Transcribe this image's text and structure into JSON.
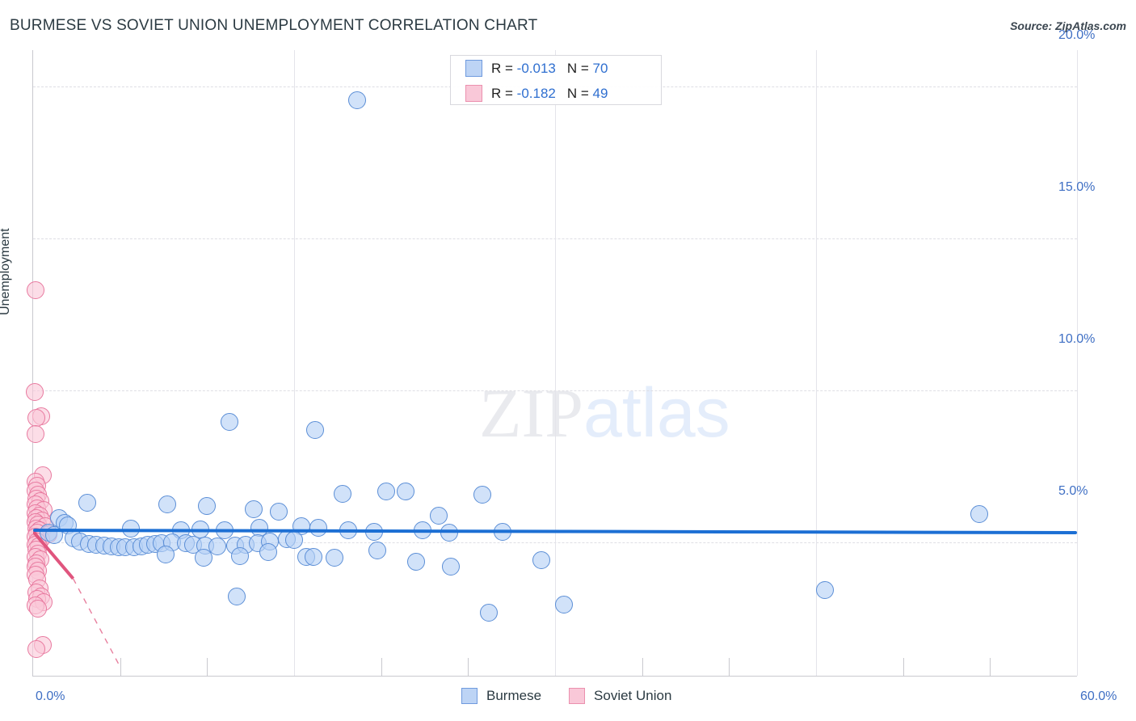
{
  "header": {
    "title": "BURMESE VS SOVIET UNION UNEMPLOYMENT CORRELATION CHART",
    "source": "Source: ZipAtlas.com"
  },
  "watermark": {
    "part1": "ZIP",
    "part2": "atlas"
  },
  "stats": {
    "rows": [
      {
        "series": "Burmese",
        "r_prefix": "R = ",
        "r_value": "-0.013",
        "n_prefix": "N = ",
        "n_value": "70",
        "color": "#bdd4f5"
      },
      {
        "series": "Soviet Union",
        "r_prefix": "R = ",
        "r_value": "-0.182",
        "n_prefix": "N = ",
        "n_value": "49",
        "color": "#f9c8d8"
      }
    ]
  },
  "legend": {
    "items": [
      {
        "label": "Burmese",
        "color": "#bdd4f5"
      },
      {
        "label": "Soviet Union",
        "color": "#f9c8d8"
      }
    ]
  },
  "axes": {
    "y_title": "Unemployment",
    "y_ticks": [
      "20.0%",
      "15.0%",
      "10.0%",
      "5.0%"
    ],
    "x_min_label": "0.0%",
    "x_max_label": "60.0%"
  },
  "chart_data": {
    "type": "scatter",
    "title": "BURMESE VS SOVIET UNION UNEMPLOYMENT CORRELATION CHART",
    "xlabel": "",
    "ylabel": "Unemployment",
    "xlim": [
      0,
      60
    ],
    "ylim": [
      0.6,
      21.2
    ],
    "x_unit": "%",
    "y_unit": "%",
    "grid": true,
    "x_ticks": [
      0,
      5,
      10,
      15,
      20,
      25,
      30,
      35,
      40,
      45,
      50,
      55,
      60
    ],
    "y_ticks": [
      5,
      10,
      15,
      20
    ],
    "legend_position": "bottom",
    "series": [
      {
        "name": "Burmese",
        "color": "#bdd4f5",
        "border_color": "#5b8ed6",
        "r": -0.013,
        "n": 70,
        "trend": {
          "type": "linear",
          "x0": 0,
          "y0": 5.38,
          "x1": 60,
          "y1": 5.3,
          "color": "#1c6fd4"
        },
        "points": [
          [
            18.6,
            19.55
          ],
          [
            11.3,
            8.95
          ],
          [
            16.2,
            8.7
          ],
          [
            17.8,
            6.6
          ],
          [
            20.3,
            6.68
          ],
          [
            21.4,
            6.66
          ],
          [
            25.8,
            6.55
          ],
          [
            3.1,
            6.3
          ],
          [
            7.7,
            6.23
          ],
          [
            10.0,
            6.18
          ],
          [
            12.7,
            6.08
          ],
          [
            14.1,
            6.0
          ],
          [
            23.3,
            5.88
          ],
          [
            54.4,
            5.92
          ],
          [
            1.5,
            5.8
          ],
          [
            1.8,
            5.62
          ],
          [
            2.0,
            5.55
          ],
          [
            5.6,
            5.45
          ],
          [
            8.5,
            5.4
          ],
          [
            9.6,
            5.42
          ],
          [
            11.0,
            5.38
          ],
          [
            13.0,
            5.48
          ],
          [
            15.4,
            5.52
          ],
          [
            16.4,
            5.46
          ],
          [
            18.1,
            5.4
          ],
          [
            19.6,
            5.35
          ],
          [
            22.4,
            5.38
          ],
          [
            23.9,
            5.3
          ],
          [
            27.0,
            5.34
          ],
          [
            0.9,
            5.3
          ],
          [
            1.2,
            5.22
          ],
          [
            2.3,
            5.12
          ],
          [
            2.7,
            5.02
          ],
          [
            3.2,
            4.95
          ],
          [
            3.6,
            4.92
          ],
          [
            4.1,
            4.88
          ],
          [
            4.5,
            4.86
          ],
          [
            4.9,
            4.84
          ],
          [
            5.3,
            4.82
          ],
          [
            5.8,
            4.84
          ],
          [
            6.2,
            4.86
          ],
          [
            6.6,
            4.9
          ],
          [
            7.0,
            4.94
          ],
          [
            7.4,
            4.96
          ],
          [
            8.0,
            4.98
          ],
          [
            8.8,
            4.96
          ],
          [
            9.2,
            4.92
          ],
          [
            9.9,
            4.88
          ],
          [
            10.6,
            4.86
          ],
          [
            11.6,
            4.88
          ],
          [
            12.2,
            4.92
          ],
          [
            12.9,
            4.96
          ],
          [
            13.6,
            5.02
          ],
          [
            14.6,
            5.1
          ],
          [
            15.0,
            5.08
          ],
          [
            7.6,
            4.6
          ],
          [
            9.8,
            4.48
          ],
          [
            11.9,
            4.55
          ],
          [
            13.5,
            4.68
          ],
          [
            15.7,
            4.52
          ],
          [
            16.1,
            4.5
          ],
          [
            17.3,
            4.48
          ],
          [
            19.8,
            4.72
          ],
          [
            22.0,
            4.35
          ],
          [
            24.0,
            4.18
          ],
          [
            29.2,
            4.4
          ],
          [
            11.7,
            3.2
          ],
          [
            26.2,
            2.68
          ],
          [
            30.5,
            2.95
          ],
          [
            45.5,
            3.42
          ]
        ]
      },
      {
        "name": "Soviet Union",
        "color": "#f9c8d8",
        "border_color": "#e8799f",
        "r": -0.182,
        "n": 49,
        "trend": {
          "type": "linear",
          "x0": 0,
          "y0": 5.35,
          "x1": 2.3,
          "y1": 3.8,
          "color": "#e0557e",
          "dashed_extension": {
            "x0": 2.3,
            "y0": 3.8,
            "x1": 4.9,
            "y1": 1.0
          }
        },
        "points": [
          [
            0.12,
            13.3
          ],
          [
            0.1,
            9.95
          ],
          [
            0.45,
            9.15
          ],
          [
            0.18,
            9.1
          ],
          [
            0.12,
            8.55
          ],
          [
            0.55,
            7.2
          ],
          [
            0.16,
            7.0
          ],
          [
            0.22,
            6.85
          ],
          [
            0.14,
            6.7
          ],
          [
            0.3,
            6.55
          ],
          [
            0.18,
            6.42
          ],
          [
            0.4,
            6.35
          ],
          [
            0.12,
            6.25
          ],
          [
            0.25,
            6.12
          ],
          [
            0.6,
            6.05
          ],
          [
            0.15,
            5.95
          ],
          [
            0.35,
            5.88
          ],
          [
            0.2,
            5.8
          ],
          [
            0.5,
            5.72
          ],
          [
            0.13,
            5.65
          ],
          [
            0.28,
            5.58
          ],
          [
            0.7,
            5.52
          ],
          [
            0.17,
            5.45
          ],
          [
            0.38,
            5.38
          ],
          [
            0.22,
            5.3
          ],
          [
            0.9,
            5.25
          ],
          [
            0.15,
            5.18
          ],
          [
            0.45,
            5.1
          ],
          [
            0.25,
            5.02
          ],
          [
            0.12,
            4.92
          ],
          [
            0.33,
            4.85
          ],
          [
            0.18,
            4.75
          ],
          [
            0.28,
            4.62
          ],
          [
            0.14,
            4.5
          ],
          [
            0.4,
            4.42
          ],
          [
            0.2,
            4.3
          ],
          [
            0.16,
            4.18
          ],
          [
            0.3,
            4.05
          ],
          [
            0.12,
            3.92
          ],
          [
            0.22,
            3.78
          ],
          [
            0.35,
            3.48
          ],
          [
            0.18,
            3.35
          ],
          [
            0.45,
            3.22
          ],
          [
            0.25,
            3.12
          ],
          [
            0.6,
            3.02
          ],
          [
            0.15,
            2.92
          ],
          [
            0.3,
            2.82
          ],
          [
            0.55,
            1.62
          ],
          [
            0.18,
            1.48
          ]
        ]
      }
    ]
  }
}
